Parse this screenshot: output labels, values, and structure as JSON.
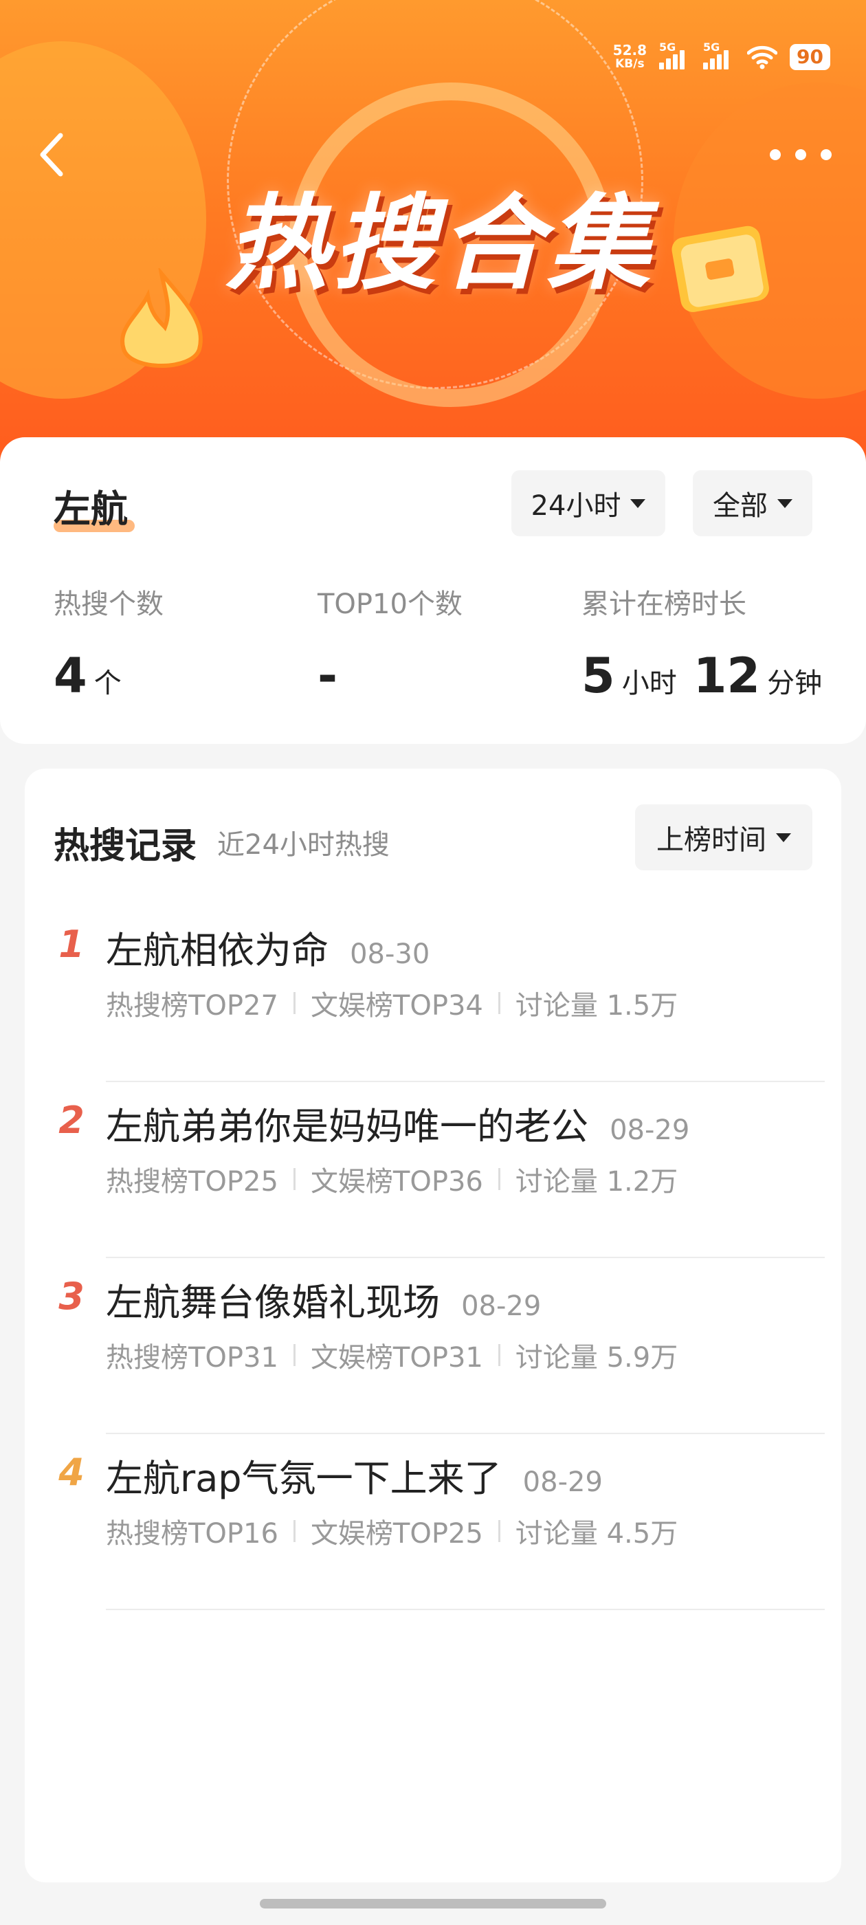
{
  "status_bar": {
    "net_speed_value": "52.8",
    "net_speed_unit": "KB/s",
    "sim1": "5G",
    "sim2": "5G",
    "battery": "90"
  },
  "header": {
    "banner_title": "热搜合集"
  },
  "summary": {
    "person_name": "左航",
    "time_filter": "24小时",
    "scope_filter": "全部",
    "stats": [
      {
        "label": "热搜个数",
        "value": "4",
        "unit": "个"
      },
      {
        "label": "TOP10个数",
        "value": "-",
        "unit": ""
      },
      {
        "label": "累计在榜时长",
        "hours": "5",
        "hours_unit": "小时",
        "minutes": "12",
        "minutes_unit": "分钟"
      }
    ]
  },
  "records": {
    "title": "热搜记录",
    "subtitle": "近24小时热搜",
    "sort_label": "上榜时间",
    "items": [
      {
        "rank": "1",
        "title": "左航相依为命",
        "date": "08-30",
        "hot": "热搜榜TOP27",
        "ent": "文娱榜TOP34",
        "discuss": "讨论量 1.5万"
      },
      {
        "rank": "2",
        "title": "左航弟弟你是妈妈唯一的老公",
        "date": "08-29",
        "hot": "热搜榜TOP25",
        "ent": "文娱榜TOP36",
        "discuss": "讨论量 1.2万"
      },
      {
        "rank": "3",
        "title": "左航舞台像婚礼现场",
        "date": "08-29",
        "hot": "热搜榜TOP31",
        "ent": "文娱榜TOP31",
        "discuss": "讨论量 5.9万"
      },
      {
        "rank": "4",
        "title": "左航rap气氛一下上来了",
        "date": "08-29",
        "hot": "热搜榜TOP16",
        "ent": "文娱榜TOP25",
        "discuss": "讨论量 4.5万"
      }
    ]
  },
  "colors": {
    "hero_top": "#ff9a2e",
    "hero_bottom": "#ff5a1e",
    "rank_red": "#e8604c",
    "rank_gold": "#f0a545",
    "highlight_underline": "#ffb980"
  }
}
